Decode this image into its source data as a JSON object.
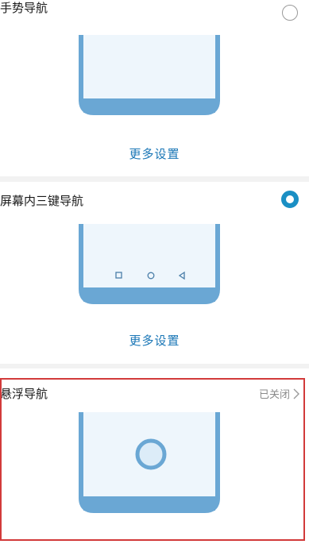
{
  "options": [
    {
      "id": "gesture",
      "title": "手势导航",
      "more_label": "更多设置",
      "selected": false
    },
    {
      "id": "three_key",
      "title": "屏幕内三键导航",
      "more_label": "更多设置",
      "selected": true
    },
    {
      "id": "floating",
      "title": "悬浮导航",
      "status": "已关闭"
    }
  ],
  "colors": {
    "accent": "#1a8fc4",
    "phone_frame": "#6aa7d4",
    "phone_screen": "#eef6fc",
    "link": "#1976b6",
    "highlight_border": "#d23a3a"
  },
  "icons": [
    "radio-unselected-icon",
    "radio-selected-icon",
    "square-nav-icon",
    "circle-nav-icon",
    "triangle-back-icon",
    "chevron-right-icon",
    "floating-button-icon"
  ]
}
